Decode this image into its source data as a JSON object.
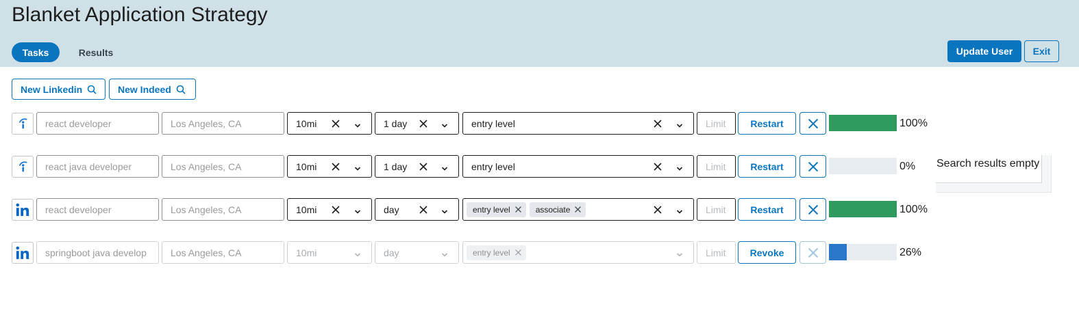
{
  "app": {
    "title": "Blanket Application Strategy"
  },
  "tabs": [
    {
      "label": "Tasks",
      "active": true
    },
    {
      "label": "Results",
      "active": false
    }
  ],
  "header_buttons": {
    "update_user": "Update User",
    "exit": "Exit"
  },
  "actions": {
    "new_linkedin": "New Linkedin",
    "new_indeed": "New Indeed"
  },
  "colors": {
    "accent": "#0a75bf",
    "header_bg": "#d0e0e7",
    "progress_done": "#2e9a5d",
    "progress_active": "#2a77c9",
    "progress_track": "#e7ecf1"
  },
  "rows": [
    {
      "site": "indeed",
      "keywords_placeholder": "react developer",
      "location_placeholder": "Los Angeles, CA",
      "distance": "10mi",
      "date": "1 day",
      "experience": "entry level",
      "chips": [],
      "limit_placeholder": "Limit",
      "action": "Restart",
      "progress": 1.0,
      "progress_text": "100%",
      "disabled": false
    },
    {
      "site": "indeed",
      "keywords_placeholder": "react java developer",
      "location_placeholder": "Los Angeles, CA",
      "distance": "10mi",
      "date": "1 day",
      "experience": "entry level",
      "chips": [],
      "limit_placeholder": "Limit",
      "action": "Restart",
      "progress": 0.0,
      "progress_text": "0%",
      "disabled": false
    },
    {
      "site": "linkedin",
      "keywords_placeholder": "react developer",
      "location_placeholder": "Los Angeles, CA",
      "distance": "10mi",
      "date": "day",
      "experience": "",
      "chips": [
        "entry level",
        "associate"
      ],
      "limit_placeholder": "Limit",
      "action": "Restart",
      "progress": 1.0,
      "progress_text": "100%",
      "disabled": false
    },
    {
      "site": "linkedin",
      "keywords_placeholder": "springboot java develop",
      "location_placeholder": "Los Angeles, CA",
      "distance": "10mi",
      "date": "day",
      "experience": "",
      "chips": [
        "entry level"
      ],
      "limit_placeholder": "Limit",
      "action": "Revoke",
      "progress": 0.26,
      "progress_text": "26%",
      "disabled": true
    }
  ],
  "results_panel": {
    "message": "Search results empty"
  }
}
